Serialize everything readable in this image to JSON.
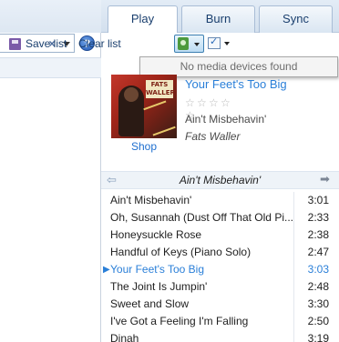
{
  "tabs": [
    {
      "label": "Play"
    },
    {
      "label": "Burn"
    },
    {
      "label": "Sync"
    }
  ],
  "search": {
    "clear_icon": "×",
    "help_icon": "?"
  },
  "toolbar": {
    "save_label": "Save list",
    "clear_label": "Clear list"
  },
  "popup": {
    "message": "No media devices found"
  },
  "now_playing": {
    "title": "Your Feet's Too Big",
    "rating_stars": 0,
    "rating_max": 5,
    "album": "Ain't Misbehavin'",
    "artist": "Fats Waller",
    "shop_label": "Shop",
    "album_art_text": "FATS WALLER"
  },
  "playlist": {
    "title": "Ain't Misbehavin'",
    "prev_icon": "⇦",
    "next_icon": "➡",
    "tracks": [
      {
        "title": "Ain't Misbehavin'",
        "duration": "3:01",
        "playing": false
      },
      {
        "title": "Oh, Susannah (Dust Off That Old Pi...",
        "duration": "2:33",
        "playing": false
      },
      {
        "title": "Honeysuckle Rose",
        "duration": "2:38",
        "playing": false
      },
      {
        "title": "Handful of Keys (Piano Solo)",
        "duration": "2:47",
        "playing": false
      },
      {
        "title": "Your Feet's Too Big",
        "duration": "3:03",
        "playing": true
      },
      {
        "title": "The Joint Is Jumpin'",
        "duration": "2:48",
        "playing": false
      },
      {
        "title": "Sweet and Slow",
        "duration": "3:30",
        "playing": false
      },
      {
        "title": "I've Got a Feeling I'm Falling",
        "duration": "2:50",
        "playing": false
      },
      {
        "title": "Dinah",
        "duration": "3:19",
        "playing": false
      }
    ]
  },
  "colors": {
    "accent": "#2a7fd8",
    "link": "#1f6fcf",
    "tab_text": "#1a3f6e"
  }
}
